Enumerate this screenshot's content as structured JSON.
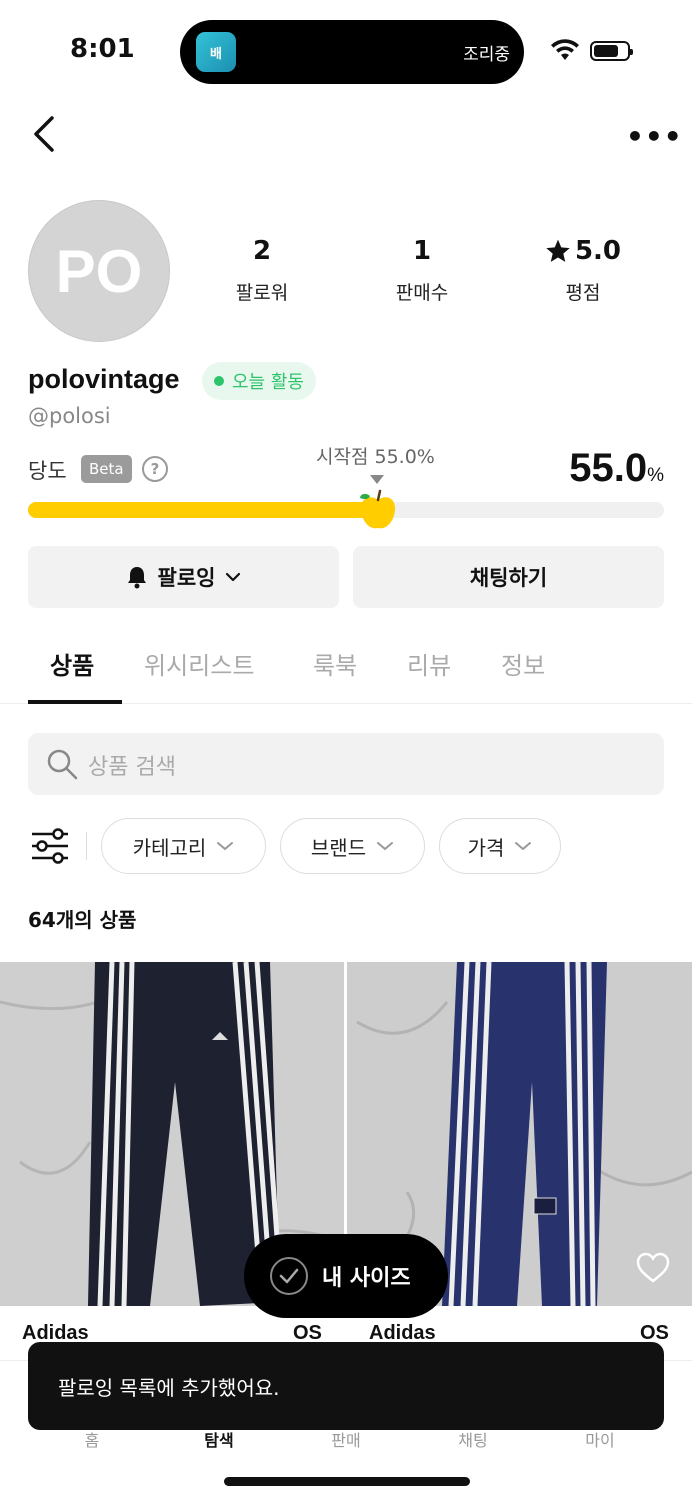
{
  "status_bar": {
    "time": "8:01",
    "live_activity_app": "배",
    "live_activity_text": "조리중"
  },
  "profile": {
    "avatar_text": "PO",
    "stats": [
      {
        "value": "2",
        "label": "팔로워"
      },
      {
        "value": "1",
        "label": "판매수"
      },
      {
        "value": "5.0",
        "label": "평점"
      }
    ],
    "username": "polovintage",
    "active_badge": "오늘 활동",
    "handle": "@polosi",
    "sweetness_label": "당도",
    "beta_label": "Beta",
    "help_label": "?",
    "start_label": "시작점 55.0%",
    "sweetness_value": "55.0",
    "sweetness_unit": "%",
    "sweetness_fraction": 0.55
  },
  "actions": {
    "follow_label": "팔로잉",
    "chat_label": "채팅하기"
  },
  "tabs": [
    {
      "label": "상품",
      "active": true
    },
    {
      "label": "위시리스트"
    },
    {
      "label": "룩북"
    },
    {
      "label": "리뷰"
    },
    {
      "label": "정보"
    }
  ],
  "search": {
    "placeholder": "상품 검색"
  },
  "filters": {
    "chips": [
      {
        "label": "카테고리"
      },
      {
        "label": "브랜드"
      },
      {
        "label": "가격"
      }
    ]
  },
  "product_count": {
    "number": "64",
    "suffix": "개의 상품"
  },
  "products": [
    {
      "brand": "Adidas",
      "size": "OS"
    },
    {
      "brand": "Adidas",
      "size": "OS"
    }
  ],
  "my_size_label": "내 사이즈",
  "bottom_nav": [
    {
      "label": "홈"
    },
    {
      "label": "탐색",
      "active": true
    },
    {
      "label": "판매"
    },
    {
      "label": "채팅"
    },
    {
      "label": "마이"
    }
  ],
  "toast": "팔로잉 목록에 추가했어요.",
  "colors": {
    "accent_yellow": "#ffcd00",
    "active_green": "#2ec46b"
  }
}
